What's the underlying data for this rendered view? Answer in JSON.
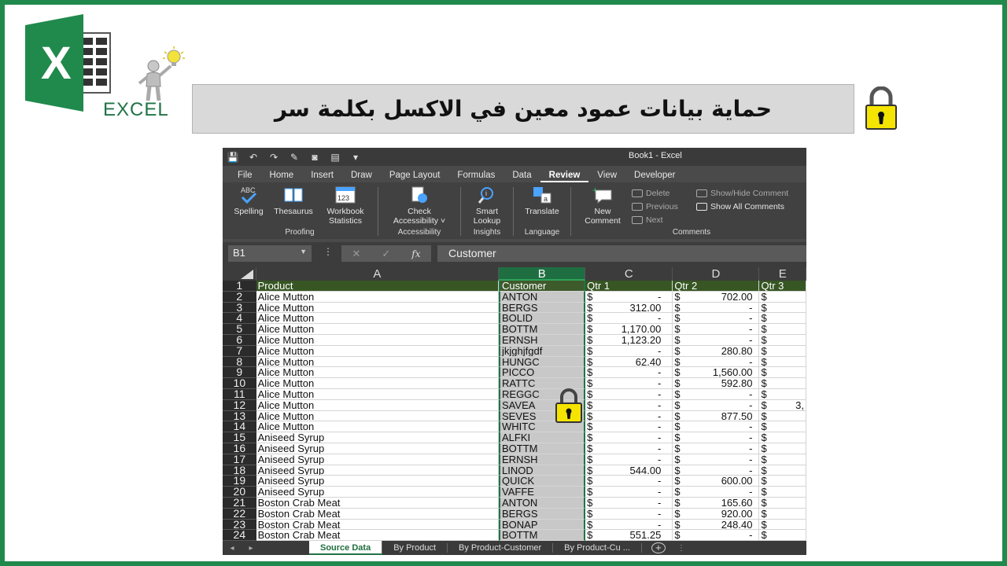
{
  "banner": {
    "logo_text": "EXCEL",
    "title": "حماية بيانات عمود معين في الاكسل  بكلمة سر"
  },
  "excel": {
    "window_title": "Book1  -  Excel",
    "menu": [
      "File",
      "Home",
      "Insert",
      "Draw",
      "Page Layout",
      "Formulas",
      "Data",
      "Review",
      "View",
      "Developer"
    ],
    "active_menu": "Review",
    "ribbon": {
      "spelling": "Spelling",
      "thesaurus": "Thesaurus",
      "workbook_stats_1": "Workbook",
      "workbook_stats_2": "Statistics",
      "proofing": "Proofing",
      "check_access_1": "Check",
      "check_access_2": "Accessibility ˅",
      "accessibility": "Accessibility",
      "smart_lookup_1": "Smart",
      "smart_lookup_2": "Lookup",
      "insights": "Insights",
      "translate": "Translate",
      "language": "Language",
      "new_comment_1": "New",
      "new_comment_2": "Comment",
      "delete": "Delete",
      "previous": "Previous",
      "next": "Next",
      "show_hide": "Show/Hide Comment",
      "show_all": "Show All Comments",
      "comments": "Comments"
    },
    "name_box": "B1",
    "formula": "Customer",
    "columns": [
      "A",
      "B",
      "C",
      "D",
      "E"
    ],
    "header_row": {
      "num": "1",
      "a": "Product",
      "b": "Customer",
      "c": "Qtr 1",
      "d": "Qtr 2",
      "e": "Qtr 3"
    },
    "rows": [
      {
        "num": "2",
        "a": "Alice Mutton",
        "b": "ANTON",
        "c": "-",
        "d": "702.00"
      },
      {
        "num": "3",
        "a": "Alice Mutton",
        "b": "BERGS",
        "c": "312.00",
        "d": "-"
      },
      {
        "num": "4",
        "a": "Alice Mutton",
        "b": "BOLID",
        "c": "-",
        "d": "-"
      },
      {
        "num": "5",
        "a": "Alice Mutton",
        "b": "BOTTM",
        "c": "1,170.00",
        "d": "-"
      },
      {
        "num": "6",
        "a": "Alice Mutton",
        "b": "ERNSH",
        "c": "1,123.20",
        "d": "-"
      },
      {
        "num": "7",
        "a": "Alice Mutton",
        "b": "jkjghjfgdf",
        "c": "-",
        "d": "280.80"
      },
      {
        "num": "8",
        "a": "Alice Mutton",
        "b": "HUNGC",
        "c": "62.40",
        "d": "-"
      },
      {
        "num": "9",
        "a": "Alice Mutton",
        "b": "PICCO",
        "c": "-",
        "d": "1,560.00"
      },
      {
        "num": "10",
        "a": "Alice Mutton",
        "b": "RATTC",
        "c": "-",
        "d": "592.80"
      },
      {
        "num": "11",
        "a": "Alice Mutton",
        "b": "REGGC",
        "c": "-",
        "d": "-"
      },
      {
        "num": "12",
        "a": "Alice Mutton",
        "b": "SAVEA",
        "c": "-",
        "d": "-",
        "e": "3,"
      },
      {
        "num": "13",
        "a": "Alice Mutton",
        "b": "SEVES",
        "c": "-",
        "d": "877.50"
      },
      {
        "num": "14",
        "a": "Alice Mutton",
        "b": "WHITC",
        "c": "-",
        "d": "-"
      },
      {
        "num": "15",
        "a": "Aniseed Syrup",
        "b": "ALFKI",
        "c": "-",
        "d": "-"
      },
      {
        "num": "16",
        "a": "Aniseed Syrup",
        "b": "BOTTM",
        "c": "-",
        "d": "-"
      },
      {
        "num": "17",
        "a": "Aniseed Syrup",
        "b": "ERNSH",
        "c": "-",
        "d": "-"
      },
      {
        "num": "18",
        "a": "Aniseed Syrup",
        "b": "LINOD",
        "c": "544.00",
        "d": "-"
      },
      {
        "num": "19",
        "a": "Aniseed Syrup",
        "b": "QUICK",
        "c": "-",
        "d": "600.00"
      },
      {
        "num": "20",
        "a": "Aniseed Syrup",
        "b": "VAFFE",
        "c": "-",
        "d": "-"
      },
      {
        "num": "21",
        "a": "Boston Crab Meat",
        "b": "ANTON",
        "c": "-",
        "d": "165.60"
      },
      {
        "num": "22",
        "a": "Boston Crab Meat",
        "b": "BERGS",
        "c": "-",
        "d": "920.00"
      },
      {
        "num": "23",
        "a": "Boston Crab Meat",
        "b": "BONAP",
        "c": "-",
        "d": "248.40"
      },
      {
        "num": "24",
        "a": "Boston Crab Meat",
        "b": "BOTTM",
        "c": "551.25",
        "d": "-"
      }
    ],
    "currency": "$",
    "tabs": [
      "Source Data",
      "By Product",
      "By Product-Customer",
      "By Product-Cu ..."
    ],
    "active_tab": "Source Data"
  }
}
